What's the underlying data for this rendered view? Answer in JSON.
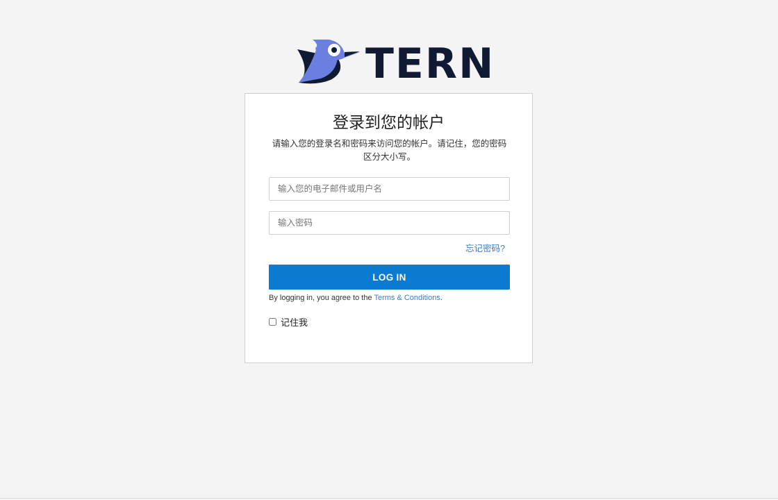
{
  "brand": {
    "logo_icon": "tern-bird-icon",
    "name": "TERN",
    "colors": {
      "dark": "#101a33",
      "accent": "#6b7fe0",
      "primary_button": "#0a7bd0",
      "link": "#2f7ed8"
    }
  },
  "login": {
    "title": "登录到您的帐户",
    "description": "请输入您的登录名和密码来访问您的帐户。请记住，您的密码区分大小写。",
    "email_placeholder": "输入您的电子邮件或用户名",
    "email_value": "",
    "password_placeholder": "输入密码",
    "password_value": "",
    "forgot_label": "忘记密码?",
    "submit_label": "LOG IN",
    "agree_prefix": "By logging in, you agree to the ",
    "agree_link": "Terms & Conditions",
    "agree_suffix": ".",
    "remember_label": "记住我",
    "remember_checked": false
  }
}
